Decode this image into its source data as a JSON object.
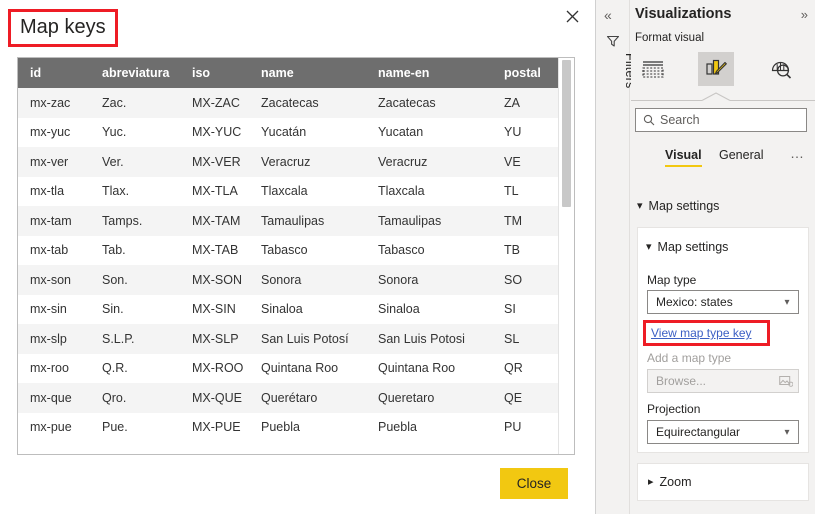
{
  "dialog": {
    "title": "Map keys",
    "close_icon": "close-x-icon",
    "close_button_label": "Close",
    "table": {
      "columns": [
        "id",
        "abreviatura",
        "iso",
        "name",
        "name-en",
        "postal"
      ],
      "rows": [
        [
          "mx-zac",
          "Zac.",
          "MX-ZAC",
          "Zacatecas",
          "Zacatecas",
          "ZA"
        ],
        [
          "mx-yuc",
          "Yuc.",
          "MX-YUC",
          "Yucatán",
          "Yucatan",
          "YU"
        ],
        [
          "mx-ver",
          "Ver.",
          "MX-VER",
          "Veracruz",
          "Veracruz",
          "VE"
        ],
        [
          "mx-tla",
          "Tlax.",
          "MX-TLA",
          "Tlaxcala",
          "Tlaxcala",
          "TL"
        ],
        [
          "mx-tam",
          "Tamps.",
          "MX-TAM",
          "Tamaulipas",
          "Tamaulipas",
          "TM"
        ],
        [
          "mx-tab",
          "Tab.",
          "MX-TAB",
          "Tabasco",
          "Tabasco",
          "TB"
        ],
        [
          "mx-son",
          "Son.",
          "MX-SON",
          "Sonora",
          "Sonora",
          "SO"
        ],
        [
          "mx-sin",
          "Sin.",
          "MX-SIN",
          "Sinaloa",
          "Sinaloa",
          "SI"
        ],
        [
          "mx-slp",
          "S.L.P.",
          "MX-SLP",
          "San Luis Potosí",
          "San Luis Potosi",
          "SL"
        ],
        [
          "mx-roo",
          "Q.R.",
          "MX-ROO",
          "Quintana Roo",
          "Quintana Roo",
          "QR"
        ],
        [
          "mx-que",
          "Qro.",
          "MX-QUE",
          "Querétaro",
          "Queretaro",
          "QE"
        ],
        [
          "mx-pue",
          "Pue.",
          "MX-PUE",
          "Puebla",
          "Puebla",
          "PU"
        ]
      ]
    }
  },
  "filters_strip": {
    "collapse_icon": "chevron-double-left-icon",
    "funnel_icon": "filter-funnel-icon",
    "label": "Filters"
  },
  "visualizations": {
    "header": "Visualizations",
    "expand_icon": "chevron-double-right-icon",
    "format_visual_label": "Format visual",
    "icons": [
      {
        "name": "fields-icon",
        "selected": false
      },
      {
        "name": "format-paint-icon",
        "selected": true
      },
      {
        "name": "analytics-magnifier-icon",
        "selected": false
      }
    ],
    "search": {
      "placeholder": "Search",
      "value": "",
      "icon": "search-icon"
    },
    "tabs": [
      {
        "label": "Visual",
        "active": true
      },
      {
        "label": "General",
        "active": false
      }
    ],
    "tabs_more_icon": "ellipsis-icon",
    "sections": {
      "map_settings_outer": {
        "label": "Map settings",
        "expanded": true,
        "chevron": "chevron-down-icon"
      },
      "map_settings_card": {
        "label": "Map settings",
        "expanded": true,
        "chevron": "chevron-down-icon",
        "map_type": {
          "label": "Map type",
          "value": "Mexico: states",
          "caret_icon": "chevron-down-icon"
        },
        "view_map_type_key_link": "View map type key",
        "add_a_map_type": {
          "label": "Add a map type",
          "placeholder": "Browse...",
          "icon": "image-browse-icon"
        },
        "projection": {
          "label": "Projection",
          "value": "Equirectangular",
          "caret_icon": "chevron-down-icon"
        }
      },
      "zoom": {
        "label": "Zoom",
        "expanded": false,
        "chevron": "chevron-right-icon"
      }
    }
  },
  "annotations": {
    "highlight_color": "#ee1c25",
    "boxes": [
      "map-keys-title",
      "view-map-type-key-link"
    ]
  }
}
